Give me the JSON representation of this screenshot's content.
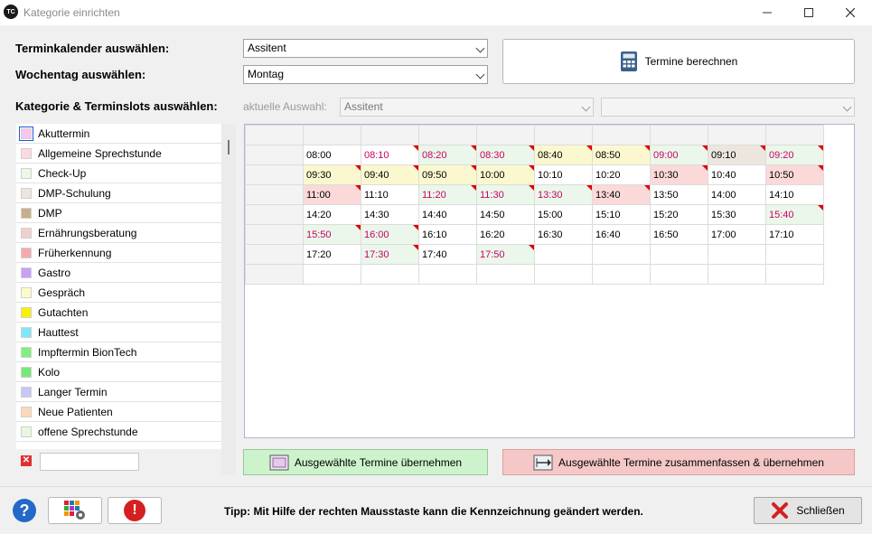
{
  "window": {
    "title": "Kategorie einrichten",
    "app_icon_text": "TC"
  },
  "labels": {
    "terminkalender": "Terminkalender auswählen:",
    "wochentag": "Wochentag auswählen:",
    "kategorie": "Kategorie & Terminslots auswählen:",
    "aktuelle": "aktuelle Auswahl:"
  },
  "fields": {
    "terminkalender_value": "Assitent",
    "wochentag_value": "Montag",
    "aktuelle_value": "Assitent",
    "extra_value": ""
  },
  "buttons": {
    "calc": "Termine berechnen",
    "apply": "Ausgewählte Termine übernehmen",
    "merge": "Ausgewählte Termine zusammenfassen & übernehmen",
    "close": "Schließen"
  },
  "tip": "Tipp: Mit Hilfe der rechten Mausstaste kann die Kennzeichnung geändert werden.",
  "categories": [
    {
      "label": "Akuttermin",
      "color": "#f7c6f0",
      "selected": true
    },
    {
      "label": "Allgemeine Sprechstunde",
      "color": "#fcd9de"
    },
    {
      "label": "Check-Up",
      "color": "#eef7e6"
    },
    {
      "label": "DMP-Schulung",
      "color": "#ede6de"
    },
    {
      "label": "DMP",
      "color": "#c9ae8a"
    },
    {
      "label": "Ernährungsberatung",
      "color": "#f2cfcf"
    },
    {
      "label": "Früherkennung",
      "color": "#f7a8ae"
    },
    {
      "label": "Gastro",
      "color": "#c7a0f7"
    },
    {
      "label": "Gespräch",
      "color": "#fcfbc8"
    },
    {
      "label": "Gutachten",
      "color": "#f7f200"
    },
    {
      "label": "Hauttest",
      "color": "#7de8f7"
    },
    {
      "label": "Impftermin BionTech",
      "color": "#7df07d"
    },
    {
      "label": "Kolo",
      "color": "#78e878"
    },
    {
      "label": "Langer Termin",
      "color": "#c6c6f7"
    },
    {
      "label": "Neue Patienten",
      "color": "#fad9b8"
    },
    {
      "label": "offene Sprechstunde",
      "color": "#e8f8e0"
    }
  ],
  "slot_rows": [
    [
      {
        "t": "08:00",
        "bg": "#ffffff",
        "fg": "#000000",
        "c": false
      },
      {
        "t": "08:10",
        "bg": "#ffffff",
        "fg": "#cc0066",
        "c": true
      },
      {
        "t": "08:20",
        "bg": "#eaf7ea",
        "fg": "#cc0066",
        "c": true
      },
      {
        "t": "08:30",
        "bg": "#eaf7ea",
        "fg": "#cc0066",
        "c": true
      },
      {
        "t": "08:40",
        "bg": "#fbf8d0",
        "fg": "#000000",
        "c": true
      },
      {
        "t": "08:50",
        "bg": "#fbf8d0",
        "fg": "#000000",
        "c": true
      },
      {
        "t": "09:00",
        "bg": "#eaf7ea",
        "fg": "#cc0066",
        "c": true
      },
      {
        "t": "09:10",
        "bg": "#ede6de",
        "fg": "#000000",
        "c": true
      },
      {
        "t": "09:20",
        "bg": "#eaf7ea",
        "fg": "#cc0066",
        "c": true
      }
    ],
    [
      {
        "t": "09:30",
        "bg": "#fbf8d0",
        "fg": "#000000",
        "c": true
      },
      {
        "t": "09:40",
        "bg": "#fbf8d0",
        "fg": "#000000",
        "c": true
      },
      {
        "t": "09:50",
        "bg": "#fbf8d0",
        "fg": "#000000",
        "c": true
      },
      {
        "t": "10:00",
        "bg": "#fbf8d0",
        "fg": "#000000",
        "c": true
      },
      {
        "t": "10:10",
        "bg": "#ffffff",
        "fg": "#000000",
        "c": false
      },
      {
        "t": "10:20",
        "bg": "#ffffff",
        "fg": "#000000",
        "c": false
      },
      {
        "t": "10:30",
        "bg": "#fbd9d9",
        "fg": "#000000",
        "c": true
      },
      {
        "t": "10:40",
        "bg": "#ffffff",
        "fg": "#000000",
        "c": false
      },
      {
        "t": "10:50",
        "bg": "#fbd9d9",
        "fg": "#000000",
        "c": true
      }
    ],
    [
      {
        "t": "11:00",
        "bg": "#fbd9d9",
        "fg": "#000000",
        "c": true
      },
      {
        "t": "11:10",
        "bg": "#ffffff",
        "fg": "#000000",
        "c": false
      },
      {
        "t": "11:20",
        "bg": "#eaf7ea",
        "fg": "#cc0066",
        "c": true
      },
      {
        "t": "11:30",
        "bg": "#eaf7ea",
        "fg": "#cc0066",
        "c": true
      },
      {
        "t": "13:30",
        "bg": "#eaf7ea",
        "fg": "#cc0066",
        "c": true
      },
      {
        "t": "13:40",
        "bg": "#fbd9d9",
        "fg": "#000000",
        "c": true
      },
      {
        "t": "13:50",
        "bg": "#ffffff",
        "fg": "#000000",
        "c": false
      },
      {
        "t": "14:00",
        "bg": "#ffffff",
        "fg": "#000000",
        "c": false
      },
      {
        "t": "14:10",
        "bg": "#ffffff",
        "fg": "#000000",
        "c": false
      }
    ],
    [
      {
        "t": "14:20",
        "bg": "#ffffff",
        "fg": "#000000",
        "c": false
      },
      {
        "t": "14:30",
        "bg": "#ffffff",
        "fg": "#000000",
        "c": false
      },
      {
        "t": "14:40",
        "bg": "#ffffff",
        "fg": "#000000",
        "c": false
      },
      {
        "t": "14:50",
        "bg": "#ffffff",
        "fg": "#000000",
        "c": false
      },
      {
        "t": "15:00",
        "bg": "#ffffff",
        "fg": "#000000",
        "c": false
      },
      {
        "t": "15:10",
        "bg": "#ffffff",
        "fg": "#000000",
        "c": false
      },
      {
        "t": "15:20",
        "bg": "#ffffff",
        "fg": "#000000",
        "c": false
      },
      {
        "t": "15:30",
        "bg": "#ffffff",
        "fg": "#000000",
        "c": false
      },
      {
        "t": "15:40",
        "bg": "#eaf7ea",
        "fg": "#cc0066",
        "c": true
      }
    ],
    [
      {
        "t": "15:50",
        "bg": "#eaf7ea",
        "fg": "#cc0066",
        "c": true
      },
      {
        "t": "16:00",
        "bg": "#eaf7ea",
        "fg": "#cc0066",
        "c": true
      },
      {
        "t": "16:10",
        "bg": "#ffffff",
        "fg": "#000000",
        "c": false
      },
      {
        "t": "16:20",
        "bg": "#ffffff",
        "fg": "#000000",
        "c": false
      },
      {
        "t": "16:30",
        "bg": "#ffffff",
        "fg": "#000000",
        "c": false
      },
      {
        "t": "16:40",
        "bg": "#ffffff",
        "fg": "#000000",
        "c": false
      },
      {
        "t": "16:50",
        "bg": "#ffffff",
        "fg": "#000000",
        "c": false
      },
      {
        "t": "17:00",
        "bg": "#ffffff",
        "fg": "#000000",
        "c": false
      },
      {
        "t": "17:10",
        "bg": "#ffffff",
        "fg": "#000000",
        "c": false
      }
    ],
    [
      {
        "t": "17:20",
        "bg": "#ffffff",
        "fg": "#000000",
        "c": false
      },
      {
        "t": "17:30",
        "bg": "#eaf7ea",
        "fg": "#cc0066",
        "c": true
      },
      {
        "t": "17:40",
        "bg": "#ffffff",
        "fg": "#000000",
        "c": false
      },
      {
        "t": "17:50",
        "bg": "#eaf7ea",
        "fg": "#cc0066",
        "c": true
      },
      {
        "t": "",
        "bg": "#ffffff",
        "fg": "#000000",
        "c": false
      },
      {
        "t": "",
        "bg": "#ffffff",
        "fg": "#000000",
        "c": false
      },
      {
        "t": "",
        "bg": "#ffffff",
        "fg": "#000000",
        "c": false
      },
      {
        "t": "",
        "bg": "#ffffff",
        "fg": "#000000",
        "c": false
      },
      {
        "t": "",
        "bg": "#ffffff",
        "fg": "#000000",
        "c": false
      }
    ],
    [
      {
        "t": "",
        "bg": "#ffffff",
        "fg": "#000000",
        "c": false
      },
      {
        "t": "",
        "bg": "#ffffff",
        "fg": "#000000",
        "c": false
      },
      {
        "t": "",
        "bg": "#ffffff",
        "fg": "#000000",
        "c": false
      },
      {
        "t": "",
        "bg": "#ffffff",
        "fg": "#000000",
        "c": false
      },
      {
        "t": "",
        "bg": "#ffffff",
        "fg": "#000000",
        "c": false
      },
      {
        "t": "",
        "bg": "#ffffff",
        "fg": "#000000",
        "c": false
      },
      {
        "t": "",
        "bg": "#ffffff",
        "fg": "#000000",
        "c": false
      },
      {
        "t": "",
        "bg": "#ffffff",
        "fg": "#000000",
        "c": false
      },
      {
        "t": "",
        "bg": "#ffffff",
        "fg": "#000000",
        "c": false
      }
    ]
  ],
  "icons": {
    "calculator": "calculator-icon",
    "apply": "calendar-apply-icon",
    "merge": "merge-slots-icon",
    "help": "help-icon",
    "settings": "settings-grid-icon",
    "alert": "alert-icon",
    "close": "close-x-icon",
    "delete": "delete-category-icon"
  },
  "help_glyph": "?",
  "alert_glyph": "!",
  "delete_glyph": "✕"
}
